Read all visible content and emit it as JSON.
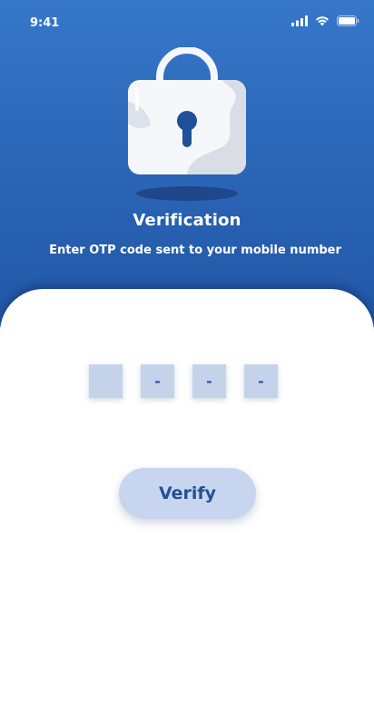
{
  "status_bar": {
    "time": "9:41",
    "icons": [
      "signal-icon",
      "wifi-icon",
      "battery-icon"
    ]
  },
  "header": {
    "illustration": "padlock-icon",
    "title": "Verification",
    "subtitle": "Enter OTP code sent to your mobile number"
  },
  "otp": {
    "digits": [
      "",
      "-",
      "-",
      "-"
    ]
  },
  "actions": {
    "verify_label": "Verify"
  },
  "colors": {
    "primary": "#2a64b5",
    "button_bg": "#c7d5ee",
    "otp_box_bg": "#c5d3ea",
    "text_accent": "#244f96"
  }
}
